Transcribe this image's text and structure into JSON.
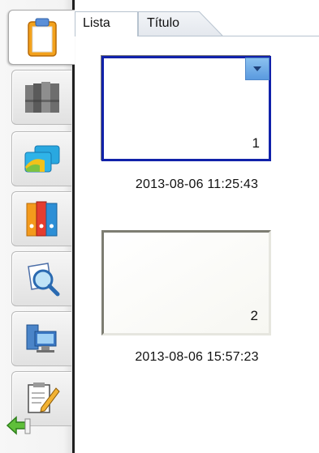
{
  "tabs": [
    {
      "label": "Lista",
      "active": true
    },
    {
      "label": "Título",
      "active": false
    }
  ],
  "sidebar": {
    "items": [
      {
        "icon": "clipboard-icon",
        "active": true
      },
      {
        "icon": "binders-icon",
        "active": false
      },
      {
        "icon": "cards-icon",
        "active": false
      },
      {
        "icon": "folders-icon",
        "active": false
      },
      {
        "icon": "search-document-icon",
        "active": false
      },
      {
        "icon": "computer-documents-icon",
        "active": false
      },
      {
        "icon": "notepad-pencil-icon",
        "active": false
      }
    ],
    "back_icon": "green-back-arrow-icon"
  },
  "thumbnails": [
    {
      "number": "1",
      "timestamp": "2013-08-06 11:25:43",
      "selected": true
    },
    {
      "number": "2",
      "timestamp": "2013-08-06 15:57:23",
      "selected": false
    }
  ],
  "colors": {
    "selection_border": "#1122aa",
    "dropdown_button": "#5a9adf"
  }
}
